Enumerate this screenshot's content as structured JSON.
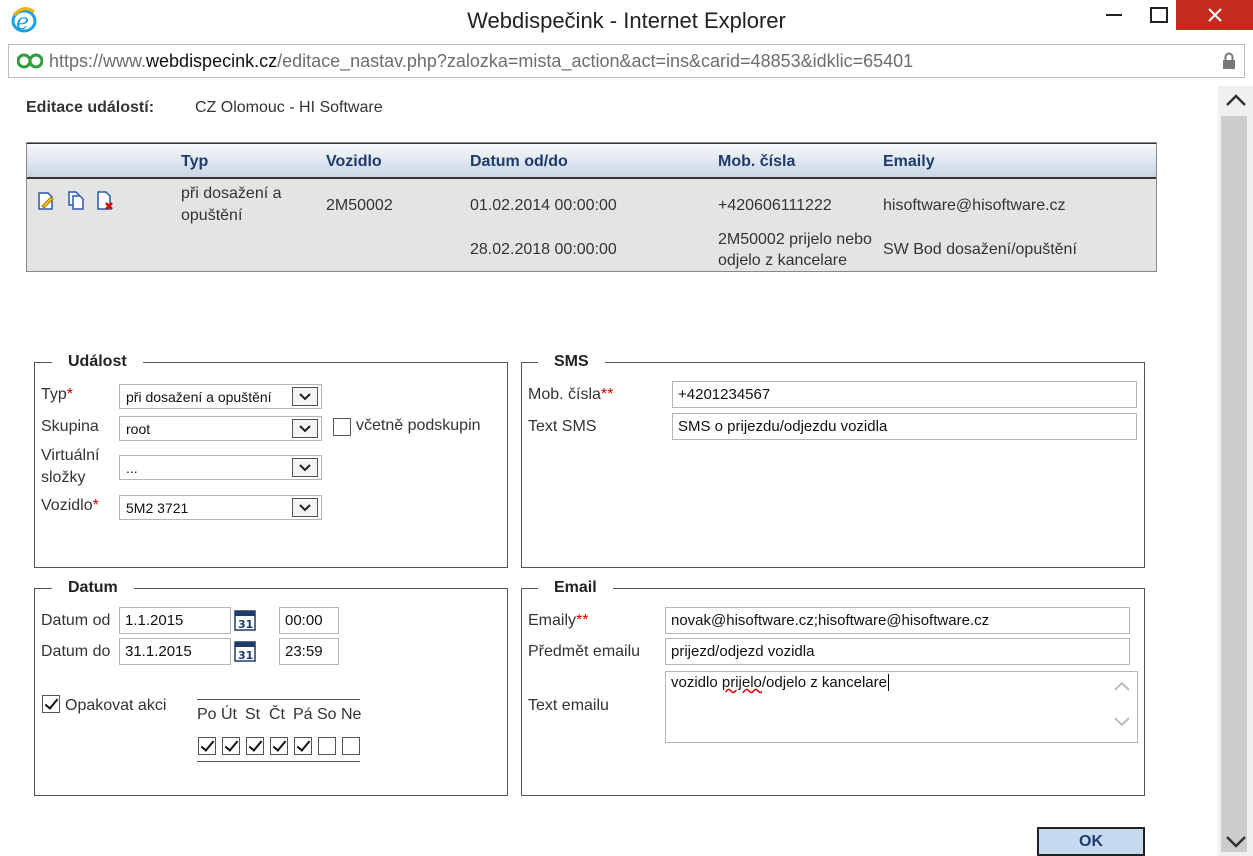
{
  "window": {
    "title": "Webdispečink - Internet Explorer"
  },
  "address": {
    "prefix": "https://www.",
    "host": "webdispecink.cz",
    "path": "/editace_nastav.php?zalozka=mista_action&act=ins&carid=48853&idklic=65401"
  },
  "header": {
    "label": "Editace událostí:",
    "value": "CZ Olomouc - HI Software"
  },
  "grid": {
    "columns": [
      "Typ",
      "Vozidlo",
      "Datum od/do",
      "Mob. čísla",
      "Emaily"
    ],
    "row": {
      "typ_line1": "při dosažení a",
      "typ_line2": "opuštění",
      "vozidlo": "2M50002",
      "datum_od": "01.02.2014 00:00:00",
      "datum_do": "28.02.2018 00:00:00",
      "mob": "+420606111222",
      "mob_text_line1": "2M50002 prijelo nebo",
      "mob_text_line2": "odjelo z kancelare",
      "email": "hisoftware@hisoftware.cz",
      "email_subject": "SW Bod dosažení/opuštění"
    }
  },
  "udalost": {
    "legend": "Událost",
    "typ_label": "Typ",
    "typ_value": "při dosažení a opuštění",
    "skupina_label": "Skupina",
    "skupina_value": "root",
    "podskupin_label": "včetně podskupin",
    "virt_label1": "Virtuální",
    "virt_label2": "složky",
    "virt_value": "...",
    "vozidlo_label": "Vozidlo",
    "vozidlo_value": "5M2 3721",
    "req_mark": "*"
  },
  "sms": {
    "legend": "SMS",
    "mob_label": "Mob. čísla",
    "req_mark": "**",
    "mob_value": "+4201234567",
    "text_label": "Text SMS",
    "text_value": "SMS o prijezdu/odjezdu vozidla"
  },
  "datum": {
    "legend": "Datum",
    "od_label": "Datum od",
    "od_date": "1.1.2015",
    "od_time": "00:00",
    "do_label": "Datum do",
    "do_date": "31.1.2015",
    "do_time": "23:59",
    "cal_day": "31",
    "repeat_label": "Opakovat akci",
    "days": [
      "Po",
      "Út",
      "St",
      "Čt",
      "Pá",
      "So",
      "Ne"
    ],
    "days_checked": [
      true,
      true,
      true,
      true,
      true,
      false,
      false
    ]
  },
  "email": {
    "legend": "Email",
    "emails_label": "Emaily",
    "req_mark": "**",
    "emails_value": "novak@hisoftware.cz;hisoftware@hisoftware.cz",
    "subject_label": "Předmět emailu",
    "subject_value": "prijezd/odjezd vozidla",
    "text_label": "Text emailu",
    "text_value_pre": "vozidlo ",
    "text_value_misspelled": "prijelo",
    "text_value_post": "/odjelo z kancelare"
  },
  "ok_label": "OK"
}
